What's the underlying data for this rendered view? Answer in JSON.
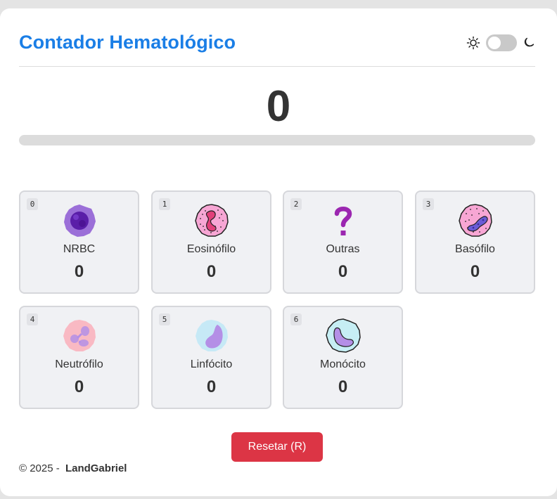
{
  "header": {
    "title": "Contador Hematológico",
    "theme_light_icon": "sun-icon",
    "theme_dark_icon": "moon-icon",
    "dark_mode": false
  },
  "total": "0",
  "progress_fraction": 0,
  "cells": [
    {
      "key": "0",
      "name": "NRBC",
      "count": "0",
      "icon": "nrbc-cell-icon"
    },
    {
      "key": "1",
      "name": "Eosinófilo",
      "count": "0",
      "icon": "eosinophil-cell-icon"
    },
    {
      "key": "2",
      "name": "Outras",
      "count": "0",
      "icon": "question-mark-icon"
    },
    {
      "key": "3",
      "name": "Basófilo",
      "count": "0",
      "icon": "basophil-cell-icon"
    },
    {
      "key": "4",
      "name": "Neutrófilo",
      "count": "0",
      "icon": "neutrophil-cell-icon"
    },
    {
      "key": "5",
      "name": "Linfócito",
      "count": "0",
      "icon": "lymphocyte-cell-icon"
    },
    {
      "key": "6",
      "name": "Monócito",
      "count": "0",
      "icon": "monocyte-cell-icon"
    }
  ],
  "reset_label": "Resetar (R)",
  "footer": {
    "copyright": "© 2025 -",
    "author": "LandGabriel"
  },
  "colors": {
    "accent": "#1a7ee6",
    "reset": "#dc3545"
  }
}
